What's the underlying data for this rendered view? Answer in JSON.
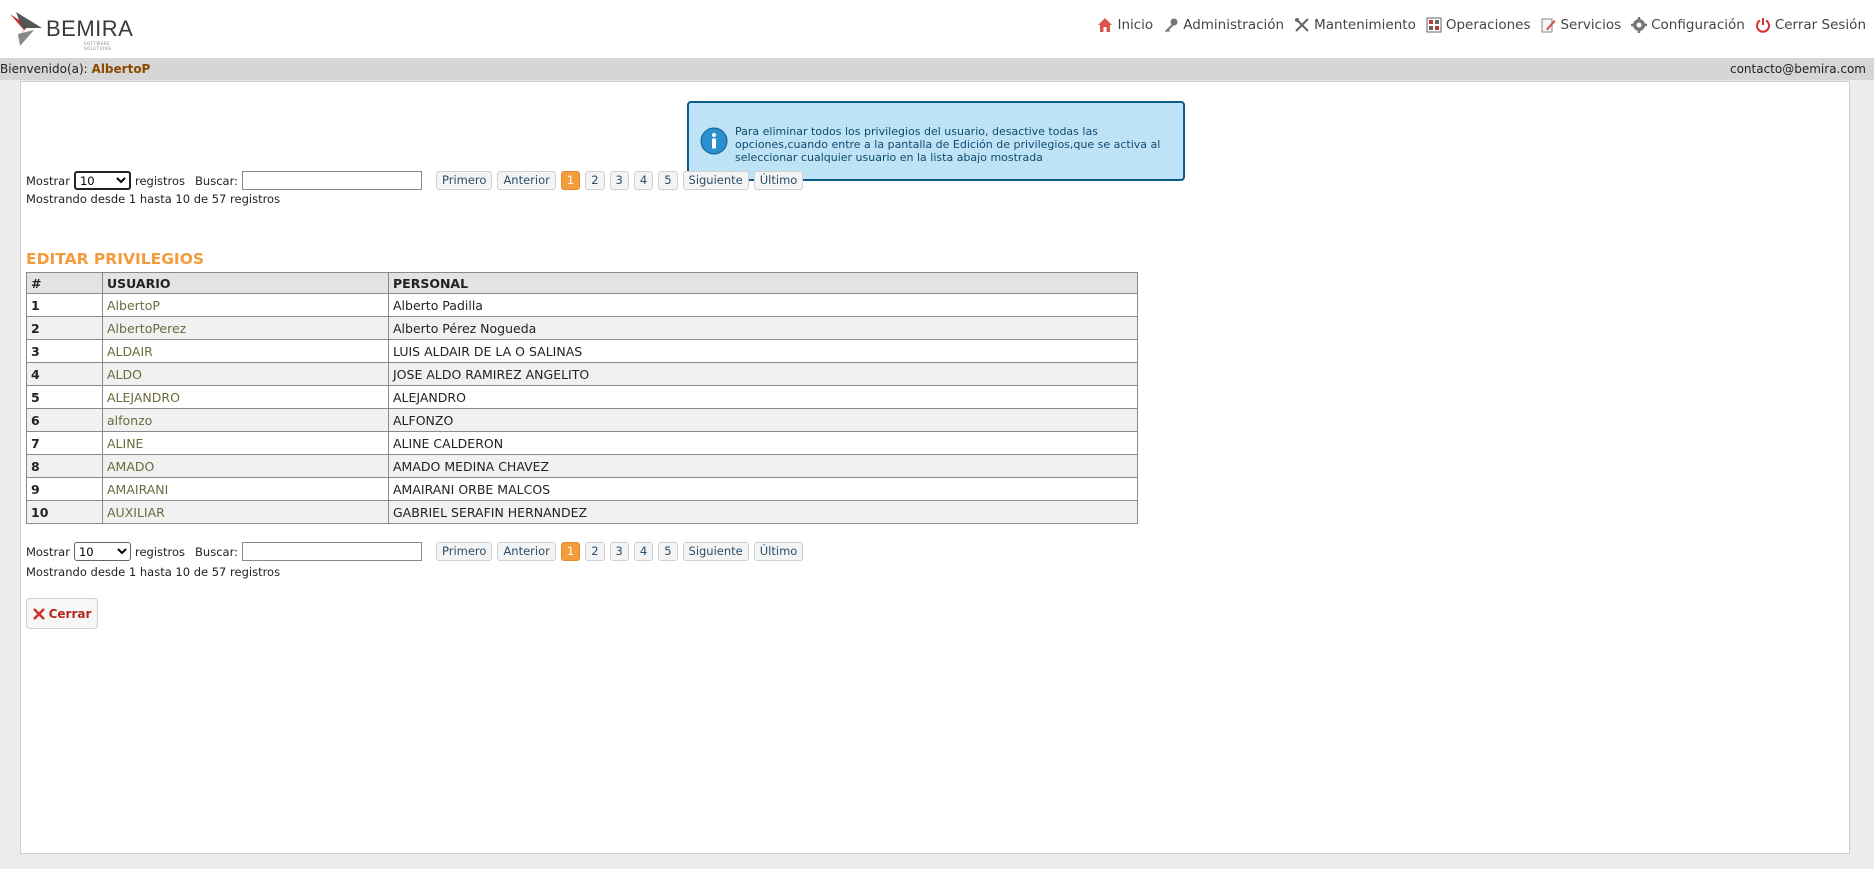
{
  "brand": {
    "name": "BEMIRA",
    "tagline": "SOFTWARE SOLUTIONS"
  },
  "nav": [
    {
      "label": "Inicio",
      "icon": "home-icon"
    },
    {
      "label": "Administración",
      "icon": "key-icon"
    },
    {
      "label": "Mantenimiento",
      "icon": "tools-icon"
    },
    {
      "label": "Operaciones",
      "icon": "grid-icon"
    },
    {
      "label": "Servicios",
      "icon": "pencil-icon"
    },
    {
      "label": "Configuración",
      "icon": "gear-icon"
    },
    {
      "label": "Cerrar Sesión",
      "icon": "power-icon"
    }
  ],
  "welcome": {
    "label": "Bienvenido(a):",
    "user": "AlbertoP",
    "email": "contacto@bemira.com"
  },
  "info": {
    "text": "Para eliminar todos los privilegios del usuario, desactive todas las opciones,cuando entre a la pantalla de Edición de privilegios,que se activa al seleccionar cualquier usuario en la lista abajo mostrada"
  },
  "controls": {
    "show_label": "Mostrar",
    "page_size": "10",
    "records_label": "registros",
    "search_label": "Buscar:",
    "search_value": "",
    "first": "Primero",
    "prev": "Anterior",
    "pages": [
      "1",
      "2",
      "3",
      "4",
      "5"
    ],
    "next": "Siguiente",
    "last": "Último",
    "showing": "Mostrando desde 1 hasta 10 de 57 registros"
  },
  "section_title": "EDITAR PRIVILEGIOS",
  "table": {
    "headers": [
      "#",
      "USUARIO",
      "PERSONAL"
    ],
    "rows": [
      [
        "1",
        "AlbertoP",
        "Alberto Padilla"
      ],
      [
        "2",
        "AlbertoPerez",
        "Alberto Pérez Nogueda"
      ],
      [
        "3",
        "ALDAIR",
        "LUIS ALDAIR DE LA O SALINAS"
      ],
      [
        "4",
        "ALDO",
        "JOSE ALDO RAMIREZ ANGELITO"
      ],
      [
        "5",
        "ALEJANDRO",
        "ALEJANDRO"
      ],
      [
        "6",
        "alfonzo",
        "ALFONZO"
      ],
      [
        "7",
        "ALINE",
        "ALINE CALDERON"
      ],
      [
        "8",
        "AMADO",
        "AMADO MEDINA CHAVEZ"
      ],
      [
        "9",
        "AMAIRANI",
        "AMAIRANI ORBE MALCOS"
      ],
      [
        "10",
        "AUXILIAR",
        "GABRIEL SERAFIN HERNANDEZ"
      ]
    ]
  },
  "close_label": "Cerrar",
  "colors": {
    "accent": "#f39c3c",
    "info_bg": "#bfe3f6",
    "info_border": "#0e5d88",
    "close": "#b3261e"
  }
}
